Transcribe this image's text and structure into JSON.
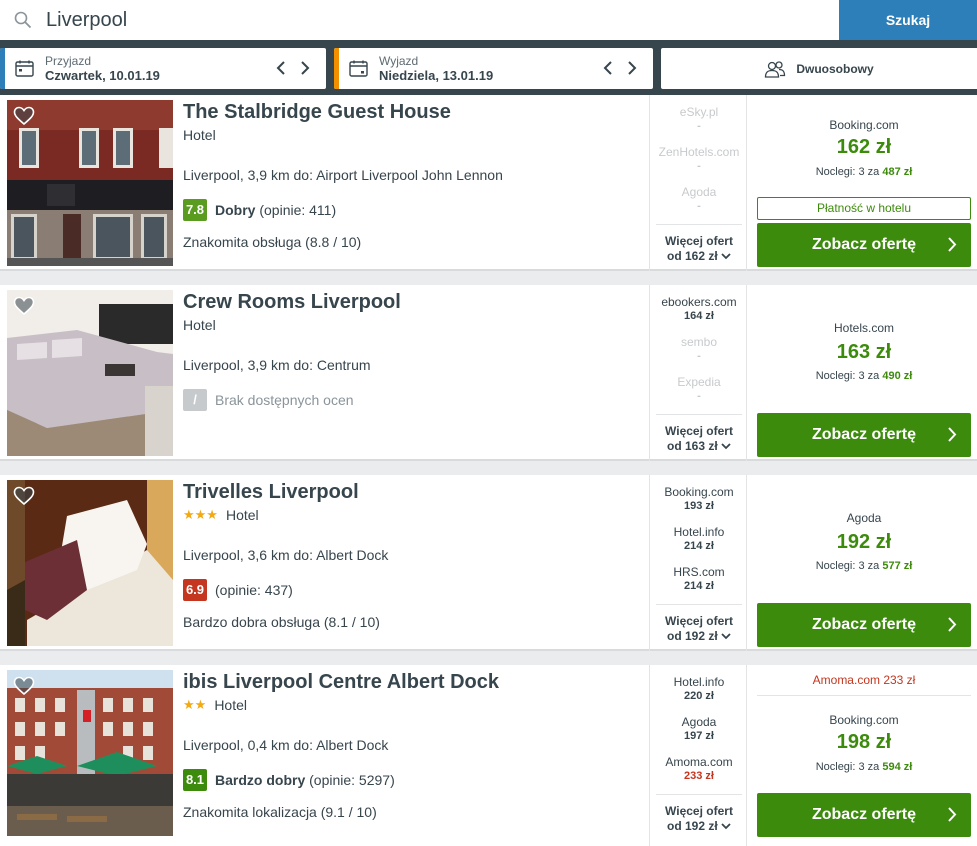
{
  "search": {
    "value": "Liverpool",
    "button_label": "Szukaj"
  },
  "filters": {
    "checkin": {
      "label": "Przyjazd",
      "value": "Czwartek, 10.01.19",
      "accent": "#2c7fb8"
    },
    "checkout": {
      "label": "Wyjazd",
      "value": "Niedziela, 13.01.19",
      "accent": "#f29000"
    },
    "room": {
      "label": "Dwuosobowy"
    }
  },
  "colors": {
    "green": "#3d8b0c",
    "score_green": "#5a9c1f",
    "score_red": "#c4361f",
    "score_none": "#c7cacc"
  },
  "results": [
    {
      "name": "The Stalbridge Guest House",
      "type": "Hotel",
      "stars": 0,
      "location": "Liverpool, 3,9 km do: Airport Liverpool John Lennon",
      "score": "7.8",
      "rating_word": "Dobry",
      "reviews": "(opinie: 411)",
      "detail": "Znakomita obsługa (8.8 / 10)",
      "offers": [
        {
          "site": "eSky.pl",
          "price": "-",
          "muted": true
        },
        {
          "site": "ZenHotels.com",
          "price": "-",
          "muted": true
        },
        {
          "site": "Agoda",
          "price": "-",
          "muted": true
        }
      ],
      "more_line1": "Więcej ofert",
      "more_line2": "od 162 zł",
      "deal": {
        "site": "Booking.com",
        "price": "162 zł",
        "nights_prefix": "Noclegi: 3 za",
        "nights_total": "487 zł",
        "pay_at_hotel": "Płatność w hotelu",
        "cta": "Zobacz ofertę"
      }
    },
    {
      "name": "Crew Rooms Liverpool",
      "type": "Hotel",
      "stars": 0,
      "location": "Liverpool, 3,9 km do: Centrum",
      "score": "/",
      "rating_word": "",
      "reviews": "Brak dostępnych ocen",
      "detail": "",
      "offers": [
        {
          "site": "ebookers.com",
          "price": "164 zł",
          "muted": false
        },
        {
          "site": "sembo",
          "price": "-",
          "muted": true
        },
        {
          "site": "Expedia",
          "price": "-",
          "muted": true
        }
      ],
      "more_line1": "Więcej ofert",
      "more_line2": "od 163 zł",
      "deal": {
        "site": "Hotels.com",
        "price": "163 zł",
        "nights_prefix": "Noclegi: 3 za",
        "nights_total": "490 zł",
        "cta": "Zobacz ofertę"
      }
    },
    {
      "name": "Trivelles Liverpool",
      "type": "Hotel",
      "stars": 3,
      "location": "Liverpool, 3,6 km do: Albert Dock",
      "score": "6.9",
      "rating_word": "",
      "reviews": "(opinie: 437)",
      "detail": "Bardzo dobra obsługa (8.1 / 10)",
      "offers": [
        {
          "site": "Booking.com",
          "price": "193 zł",
          "muted": false
        },
        {
          "site": "Hotel.info",
          "price": "214 zł",
          "muted": false
        },
        {
          "site": "HRS.com",
          "price": "214 zł",
          "muted": false
        }
      ],
      "more_line1": "Więcej ofert",
      "more_line2": "od 192 zł",
      "deal": {
        "site": "Agoda",
        "price": "192 zł",
        "nights_prefix": "Noclegi: 3 za",
        "nights_total": "577 zł",
        "cta": "Zobacz ofertę"
      }
    },
    {
      "name": "ibis Liverpool Centre Albert Dock",
      "type": "Hotel",
      "stars": 2,
      "location": "Liverpool, 0,4 km do: Albert Dock",
      "score": "8.1",
      "rating_word": "Bardzo dobry",
      "reviews": "(opinie: 5297)",
      "detail": "Znakomita lokalizacja (9.1 / 10)",
      "offers": [
        {
          "site": "Hotel.info",
          "price": "220 zł",
          "muted": false
        },
        {
          "site": "Agoda",
          "price": "197 zł",
          "muted": false
        },
        {
          "site": "Amoma.com",
          "price": "233 zł",
          "muted": false,
          "red": true
        }
      ],
      "more_line1": "Więcej ofert",
      "more_line2": "od 192 zł",
      "deal": {
        "alt_offer": "Amoma.com 233 zł",
        "site": "Booking.com",
        "price": "198 zł",
        "nights_prefix": "Noclegi: 3 za",
        "nights_total": "594 zł",
        "cta": "Zobacz ofertę"
      }
    }
  ]
}
